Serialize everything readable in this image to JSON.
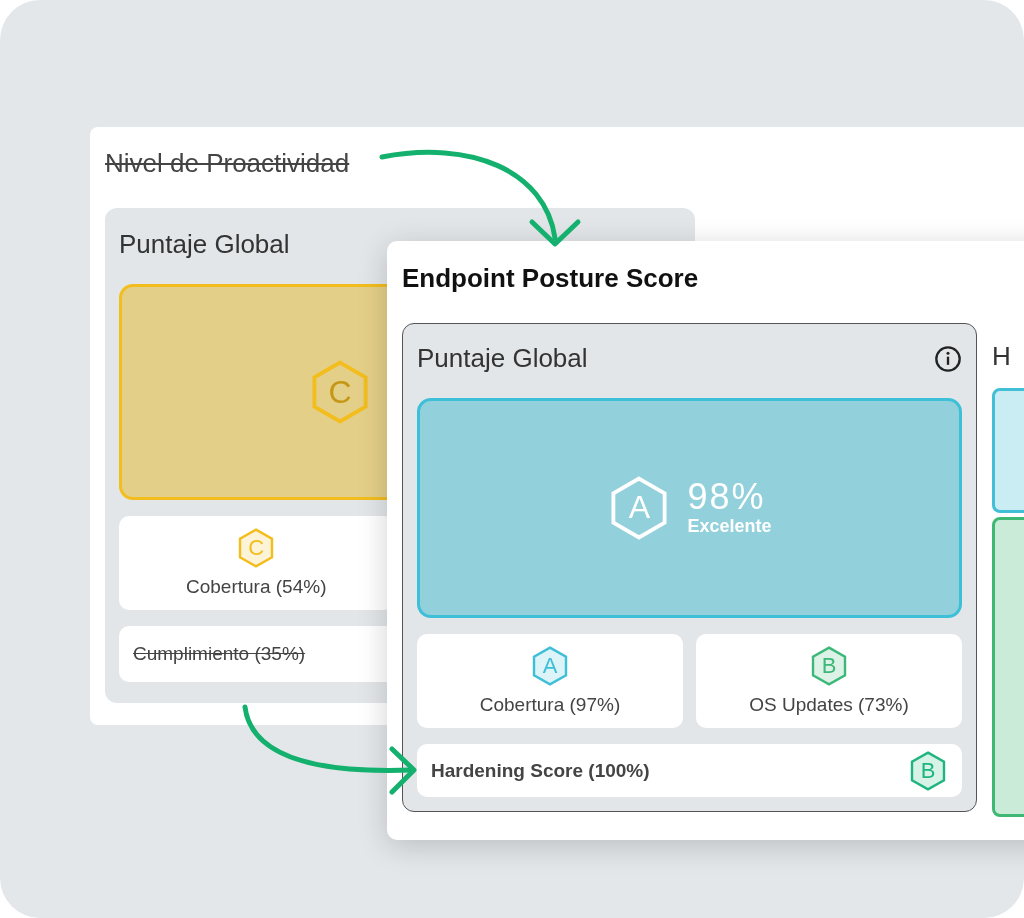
{
  "back_card": {
    "title": "Nivel de Proactividad",
    "title_struck": true,
    "panel_title": "Puntaje Global",
    "main": {
      "grade": "C",
      "color": "#f2bd1d"
    },
    "metrics": [
      {
        "kind": "tile",
        "grade": "C",
        "label": "Cobertura (54%)",
        "color": "#f2bd1d"
      },
      {
        "kind": "row",
        "label": "Cumplimiento (35%)",
        "struck": true
      }
    ]
  },
  "front_card": {
    "title": "Endpoint Posture Score",
    "panel_title": "Puntaje Global",
    "side_title": "H",
    "main": {
      "grade": "A",
      "color": "#3dbfd8",
      "score": "98%",
      "rating": "Excelente"
    },
    "metrics": [
      {
        "kind": "tile",
        "grade": "A",
        "label": "Cobertura (97%)",
        "color": "#3dbfd8"
      },
      {
        "kind": "tile",
        "grade": "B",
        "label": "OS Updates (73%)",
        "color": "#3cb878"
      },
      {
        "kind": "row",
        "grade": "B",
        "label": "Hardening Score (100%)",
        "color": "#1fb57f",
        "emphasized": true
      }
    ],
    "side_tiles": [
      {
        "color": "#40bfd7"
      },
      {
        "color": "#3fb873"
      }
    ]
  }
}
